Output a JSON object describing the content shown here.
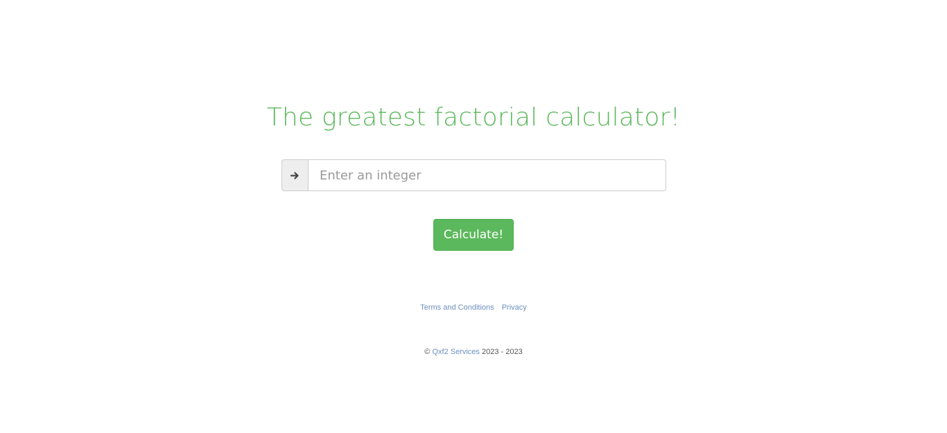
{
  "header": {
    "title": "The greatest factorial calculator!"
  },
  "form": {
    "addon_icon": "arrow-right-icon",
    "input_value": "",
    "input_placeholder": "Enter an integer",
    "submit_label": "Calculate!"
  },
  "footer": {
    "links": [
      {
        "label": "Terms and Conditions"
      },
      {
        "label": "Privacy"
      }
    ],
    "copyright_symbol": "©",
    "company_link": "Qxf2 Services",
    "years": "2023 - 2023"
  },
  "colors": {
    "accent": "#5cb85c",
    "link": "#6b8fbf"
  }
}
